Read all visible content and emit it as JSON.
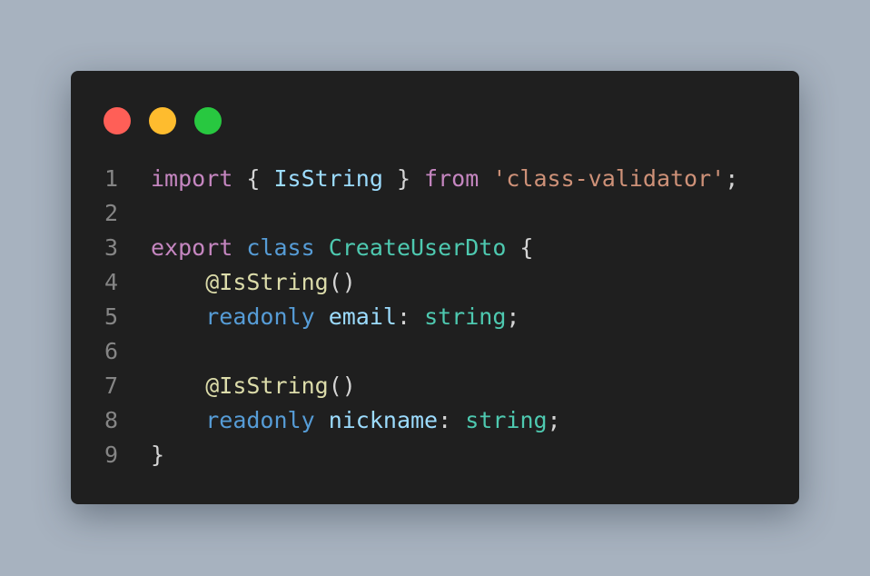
{
  "window": {
    "controls": [
      {
        "name": "close",
        "color": "#ff5f57"
      },
      {
        "name": "minimize",
        "color": "#febc2e"
      },
      {
        "name": "maximize",
        "color": "#28c840"
      }
    ]
  },
  "code": {
    "language": "typescript",
    "lines": [
      {
        "n": "1",
        "tokens": [
          {
            "t": "import",
            "k": "kw"
          },
          {
            "t": " { ",
            "k": "pn"
          },
          {
            "t": "IsString",
            "k": "id"
          },
          {
            "t": " } ",
            "k": "pn"
          },
          {
            "t": "from",
            "k": "kw"
          },
          {
            "t": " ",
            "k": "pn"
          },
          {
            "t": "'class-validator'",
            "k": "str"
          },
          {
            "t": ";",
            "k": "pn"
          }
        ]
      },
      {
        "n": "2",
        "tokens": []
      },
      {
        "n": "3",
        "tokens": [
          {
            "t": "export",
            "k": "kw"
          },
          {
            "t": " ",
            "k": "pn"
          },
          {
            "t": "class",
            "k": "kw2"
          },
          {
            "t": " ",
            "k": "pn"
          },
          {
            "t": "CreateUserDto",
            "k": "cls"
          },
          {
            "t": " {",
            "k": "pn"
          }
        ]
      },
      {
        "n": "4",
        "tokens": [
          {
            "t": "    ",
            "k": "pn"
          },
          {
            "t": "@IsString",
            "k": "fn"
          },
          {
            "t": "()",
            "k": "pn"
          }
        ]
      },
      {
        "n": "5",
        "tokens": [
          {
            "t": "    ",
            "k": "pn"
          },
          {
            "t": "readonly",
            "k": "kw2"
          },
          {
            "t": " ",
            "k": "pn"
          },
          {
            "t": "email",
            "k": "id"
          },
          {
            "t": ": ",
            "k": "pn"
          },
          {
            "t": "string",
            "k": "cls"
          },
          {
            "t": ";",
            "k": "pn"
          }
        ]
      },
      {
        "n": "6",
        "tokens": []
      },
      {
        "n": "7",
        "tokens": [
          {
            "t": "    ",
            "k": "pn"
          },
          {
            "t": "@IsString",
            "k": "fn"
          },
          {
            "t": "()",
            "k": "pn"
          }
        ]
      },
      {
        "n": "8",
        "tokens": [
          {
            "t": "    ",
            "k": "pn"
          },
          {
            "t": "readonly",
            "k": "kw2"
          },
          {
            "t": " ",
            "k": "pn"
          },
          {
            "t": "nickname",
            "k": "id"
          },
          {
            "t": ": ",
            "k": "pn"
          },
          {
            "t": "string",
            "k": "cls"
          },
          {
            "t": ";",
            "k": "pn"
          }
        ]
      },
      {
        "n": "9",
        "tokens": [
          {
            "t": "}",
            "k": "pn"
          }
        ]
      }
    ]
  }
}
